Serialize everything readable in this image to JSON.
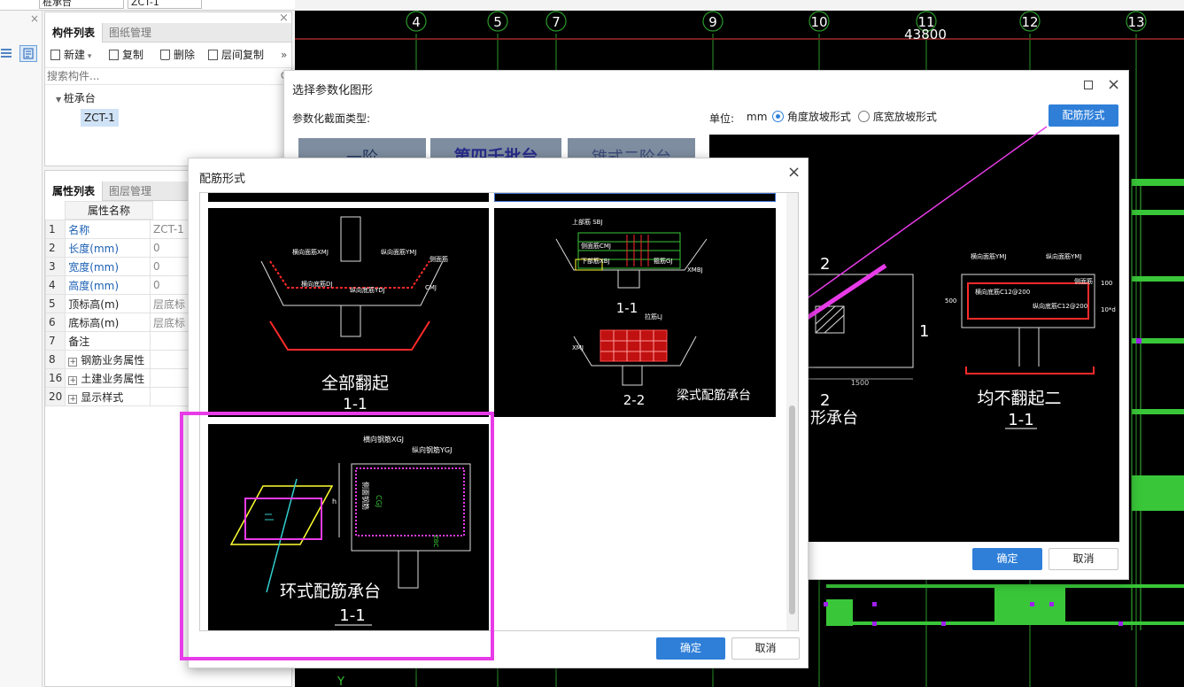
{
  "topbar": {
    "sel1": "桩承台",
    "sel2": "ZCT-1"
  },
  "component_panel": {
    "tabs": [
      "构件列表",
      "图纸管理"
    ],
    "toolbar": {
      "new": "新建",
      "copy": "复制",
      "delete": "删除",
      "layer_copy": "层间复制",
      "more": "»"
    },
    "search_placeholder": "搜索构件...",
    "tree": {
      "group": "桩承台",
      "item": "ZCT-1"
    }
  },
  "property_panel": {
    "tabs": [
      "属性列表",
      "图层管理"
    ],
    "header": "属性名称",
    "rows": [
      {
        "n": "1",
        "name": "名称",
        "val": "ZCT-1",
        "blue": true
      },
      {
        "n": "2",
        "name": "长度(mm)",
        "val": "0",
        "blue": true
      },
      {
        "n": "3",
        "name": "宽度(mm)",
        "val": "0",
        "blue": true
      },
      {
        "n": "4",
        "name": "高度(mm)",
        "val": "0",
        "blue": true
      },
      {
        "n": "5",
        "name": "顶标高(m)",
        "val": "层底标",
        "blue": false
      },
      {
        "n": "6",
        "name": "底标高(m)",
        "val": "层底标",
        "blue": false
      },
      {
        "n": "7",
        "name": "备注",
        "val": "",
        "blue": false
      },
      {
        "n": "8",
        "name": "钢筋业务属性",
        "val": "",
        "blue": false,
        "expand": true
      },
      {
        "n": "16",
        "name": "土建业务属性",
        "val": "",
        "blue": false,
        "expand": true
      },
      {
        "n": "20",
        "name": "显示样式",
        "val": "",
        "blue": false,
        "expand": true
      }
    ]
  },
  "cad": {
    "axes": [
      "4",
      "5",
      "7",
      "9",
      "10",
      "11",
      "12",
      "13"
    ],
    "dimension": "43800",
    "y_label": "Y"
  },
  "param_dialog": {
    "title": "选择参数化图形",
    "section_type_label": "参数化截面类型:",
    "unit_label": "单位:",
    "unit": "mm",
    "radio1": "角度放坡形式",
    "radio2": "底宽放坡形式",
    "rebar_button": "配筋形式",
    "ok": "确定",
    "cancel": "取消",
    "thumb_texts": [
      "一阶",
      "第四千批台",
      "锥式二阶台"
    ],
    "preview": {
      "label_top": "2",
      "label_right": "1",
      "label_bottom": "2",
      "label_partial": "形承台",
      "dim": "1500",
      "right_title": "均不翻起二",
      "right_sub": "1-1",
      "r1": "横向面筋YMJ",
      "r2": "纵向面筋YMJ",
      "r3": "横向底筋C12@200",
      "r4": "纵向底筋C12@200",
      "r5": "侧面筋",
      "r6": "500",
      "r7": "100",
      "r8": "10*d"
    }
  },
  "rebar_dialog": {
    "title": "配筋形式",
    "ok": "确定",
    "cancel": "取消",
    "img1": {
      "title": "全部翻起",
      "sub": "1-1",
      "t1": "横向面筋XMJ",
      "t2": "纵向面筋YMJ",
      "t3": "横向底筋DJ",
      "t4": "纵向底筋YDJ",
      "t5": "CMJ",
      "t6": "侧面筋"
    },
    "img2": {
      "title": "梁式配筋承台",
      "sec1": "1-1",
      "sec2": "2-2",
      "t1": "上部筋 SBJ",
      "t2": "侧面筋CMJ",
      "t3": "下部筋XBJ",
      "t4": "箍筋GJ",
      "t5": "XMBJ",
      "t6": "拉筋LJ",
      "t7": "XMJ"
    },
    "img3": {
      "title": "环式配筋承台",
      "sub": "1-1",
      "t1": "横向钢筋XGJ",
      "t2": "纵向钢筋YGJ",
      "t3": "侧面钢筋",
      "t4": "CGJ",
      "t5": "ZBC",
      "t6": "h"
    }
  },
  "colors": {
    "highlight": "#e83be8",
    "accent": "#2f7fd9",
    "cad_green": "#2a9a2a"
  }
}
